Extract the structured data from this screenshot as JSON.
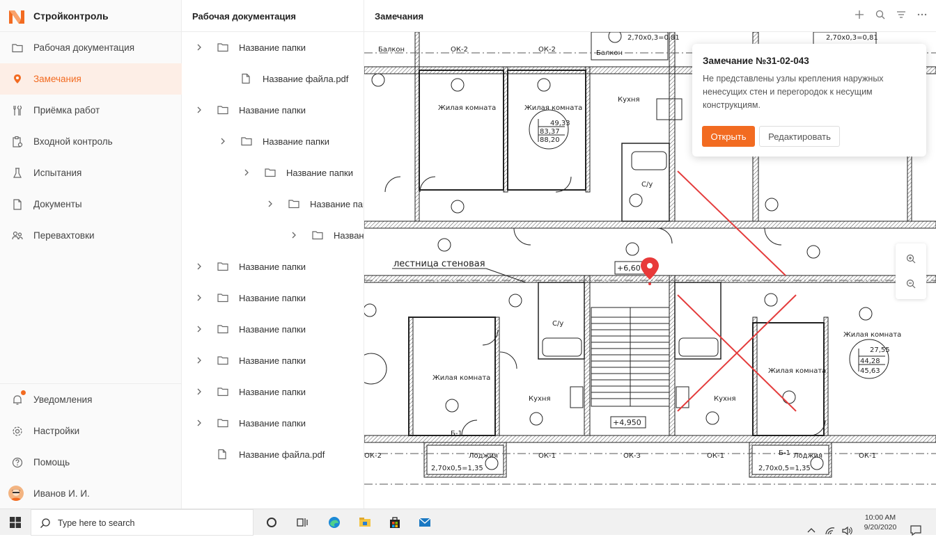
{
  "app": {
    "brand": "Стройконтроль",
    "accent": "#f26b21"
  },
  "sidebar": {
    "items": [
      {
        "label": "Рабочая документация",
        "icon": "folder-icon"
      },
      {
        "label": "Замечания",
        "icon": "location-pin-icon",
        "active": true
      },
      {
        "label": "Приёмка работ",
        "icon": "tools-icon"
      },
      {
        "label": "Входной контроль",
        "icon": "clipboard-icon"
      },
      {
        "label": "Испытания",
        "icon": "flask-icon"
      },
      {
        "label": "Документы",
        "icon": "document-icon"
      },
      {
        "label": "Перевахтовки",
        "icon": "people-icon"
      }
    ],
    "bottom": [
      {
        "label": "Уведомления",
        "icon": "bell-icon"
      },
      {
        "label": "Настройки",
        "icon": "gear-icon"
      },
      {
        "label": "Помощь",
        "icon": "help-icon"
      },
      {
        "label": "Иванов И. И.",
        "icon": "avatar"
      }
    ]
  },
  "tree": {
    "title": "Рабочая документация",
    "rows": [
      {
        "label": "Название папки",
        "type": "folder",
        "level": 0,
        "chevron": true
      },
      {
        "label": "Название файла.pdf",
        "type": "file",
        "level": 1,
        "chevron": false
      },
      {
        "label": "Название папки",
        "type": "folder",
        "level": 0,
        "chevron": true
      },
      {
        "label": "Название папки",
        "type": "folder",
        "level": 1,
        "chevron": true
      },
      {
        "label": "Название папки",
        "type": "folder",
        "level": 2,
        "chevron": true
      },
      {
        "label": "Название папки",
        "type": "folder",
        "level": 3,
        "chevron": true
      },
      {
        "label": "Название папки",
        "type": "folder",
        "level": 4,
        "chevron": true
      },
      {
        "label": "Название папки",
        "type": "folder",
        "level": 0,
        "chevron": true
      },
      {
        "label": "Название папки",
        "type": "folder",
        "level": 0,
        "chevron": true
      },
      {
        "label": "Название папки",
        "type": "folder",
        "level": 0,
        "chevron": true
      },
      {
        "label": "Название папки",
        "type": "folder",
        "level": 0,
        "chevron": true
      },
      {
        "label": "Название папки",
        "type": "folder",
        "level": 0,
        "chevron": true
      },
      {
        "label": "Название папки",
        "type": "folder",
        "level": 0,
        "chevron": true
      },
      {
        "label": "Название файла.pdf",
        "type": "file",
        "level": 0,
        "chevron": false
      }
    ]
  },
  "main": {
    "title": "Замечания",
    "header_icons": [
      "plus-icon",
      "search-icon",
      "filter-icon",
      "more-icon"
    ]
  },
  "popup": {
    "title": "Замечание №31-02-043",
    "text": "Не представлены узлы крепления наружных ненесущих стен и перегородок к несущим конструкциям.",
    "open_label": "Открыть",
    "edit_label": "Редактировать"
  },
  "plan": {
    "labels": {
      "staircase": "лестница стеновая",
      "level_upper": "+6,60",
      "level_lower": "+4,950",
      "room_living": "Жилая комната",
      "room_kitchen": "Кухня",
      "room_bath": "С/у",
      "balcony": "Балкон",
      "loggia": "Лоджия",
      "window_ok2": "ОК-2",
      "window_ok1": "ОК-1",
      "window_ok3": "ОК-3",
      "b1": "Б-1",
      "dim_top": "2,70х0,3=0,81",
      "dim_bottom": "2,70х0,5=1,35",
      "area_a": "49,33",
      "area_b": "83,37",
      "area_c": "88,20",
      "area_d": "27,55",
      "area_e": "44,28",
      "area_f": "45,63"
    }
  },
  "taskbar": {
    "search_placeholder": "Type here to search",
    "time": "10:00 AM",
    "date": "9/20/2020"
  }
}
